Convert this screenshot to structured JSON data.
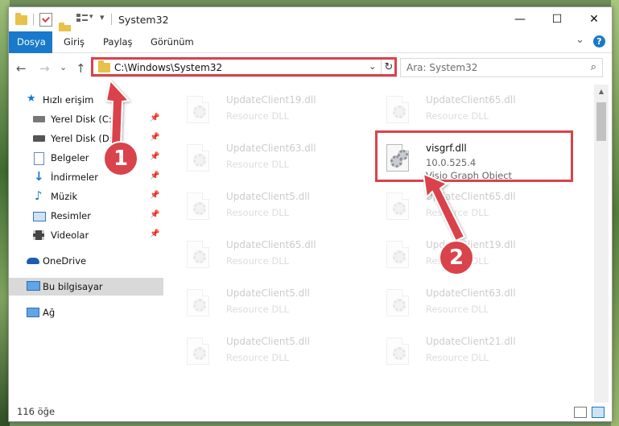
{
  "window": {
    "title": "System32",
    "controls": {
      "minimize": "—",
      "maximize": "☐",
      "close": "✕"
    }
  },
  "ribbon": {
    "tabs": [
      {
        "label": "Dosya",
        "active": true
      },
      {
        "label": "Giriş"
      },
      {
        "label": "Paylaş"
      },
      {
        "label": "Görünüm"
      }
    ],
    "expand": "⌄",
    "help": "?"
  },
  "nav": {
    "back": "←",
    "forward": "→",
    "recent": "⌄",
    "up": "↑",
    "address": "C:\\Windows\\System32",
    "address_chevron": "⌄",
    "refresh": "↻",
    "search_placeholder": "Ara: System32",
    "search_icon": "⌕"
  },
  "sidebar": {
    "items": [
      {
        "label": "Hızlı erişim",
        "icon": "star-icon",
        "pinned": false
      },
      {
        "label": "Yerel Disk (C:)",
        "icon": "drive-icon",
        "pinned": true
      },
      {
        "label": "Yerel Disk (D:)",
        "icon": "drive-icon",
        "pinned": true
      },
      {
        "label": "Belgeler",
        "icon": "documents-icon",
        "pinned": true
      },
      {
        "label": "İndirmeler",
        "icon": "downloads-icon",
        "pinned": true
      },
      {
        "label": "Müzik",
        "icon": "music-icon",
        "pinned": true
      },
      {
        "label": "Resimler",
        "icon": "pictures-icon",
        "pinned": true
      },
      {
        "label": "Videolar",
        "icon": "videos-icon",
        "pinned": true
      },
      {
        "label": "OneDrive",
        "icon": "onedrive-icon",
        "pinned": false
      },
      {
        "label": "Bu bilgisayar",
        "icon": "this-pc-icon",
        "pinned": false,
        "selected": true
      },
      {
        "label": "Ağ",
        "icon": "network-icon",
        "pinned": false
      }
    ],
    "pin_glyph": "📌"
  },
  "files": [
    {
      "name": "UpdateClient19.dll",
      "type": "Resource DLL"
    },
    {
      "name": "UpdateClient65.dll",
      "type": "Resource DLL"
    },
    {
      "name": "UpdateClient63.dll",
      "type": "Resource DLL"
    },
    {
      "name": "visgrf.dll",
      "version": "10.0.525.4",
      "type": "Visio Graph Object",
      "highlighted": true
    },
    {
      "name": "UpdateClient5.dll",
      "type": "Resource DLL"
    },
    {
      "name": "UpdateClient65.dll",
      "type": "Resource DLL"
    },
    {
      "name": "UpdateClient65.dll",
      "type": "Resource DLL"
    },
    {
      "name": "UpdateClient19.dll",
      "type": "Resource DLL"
    },
    {
      "name": "UpdateClient5.dll",
      "type": "Resource DLL"
    },
    {
      "name": "UpdateClient63.dll",
      "type": "Resource DLL"
    },
    {
      "name": "UpdateClient5.dll",
      "type": "Resource DLL"
    },
    {
      "name": "UpdateClient21.dll",
      "type": "Resource DLL"
    }
  ],
  "status": {
    "item_count": "116 öğe"
  },
  "annotations": {
    "step1": "1",
    "step2": "2",
    "color": "#d9434c"
  },
  "colors": {
    "accent": "#1979ca",
    "folder": "#e8c14a"
  }
}
